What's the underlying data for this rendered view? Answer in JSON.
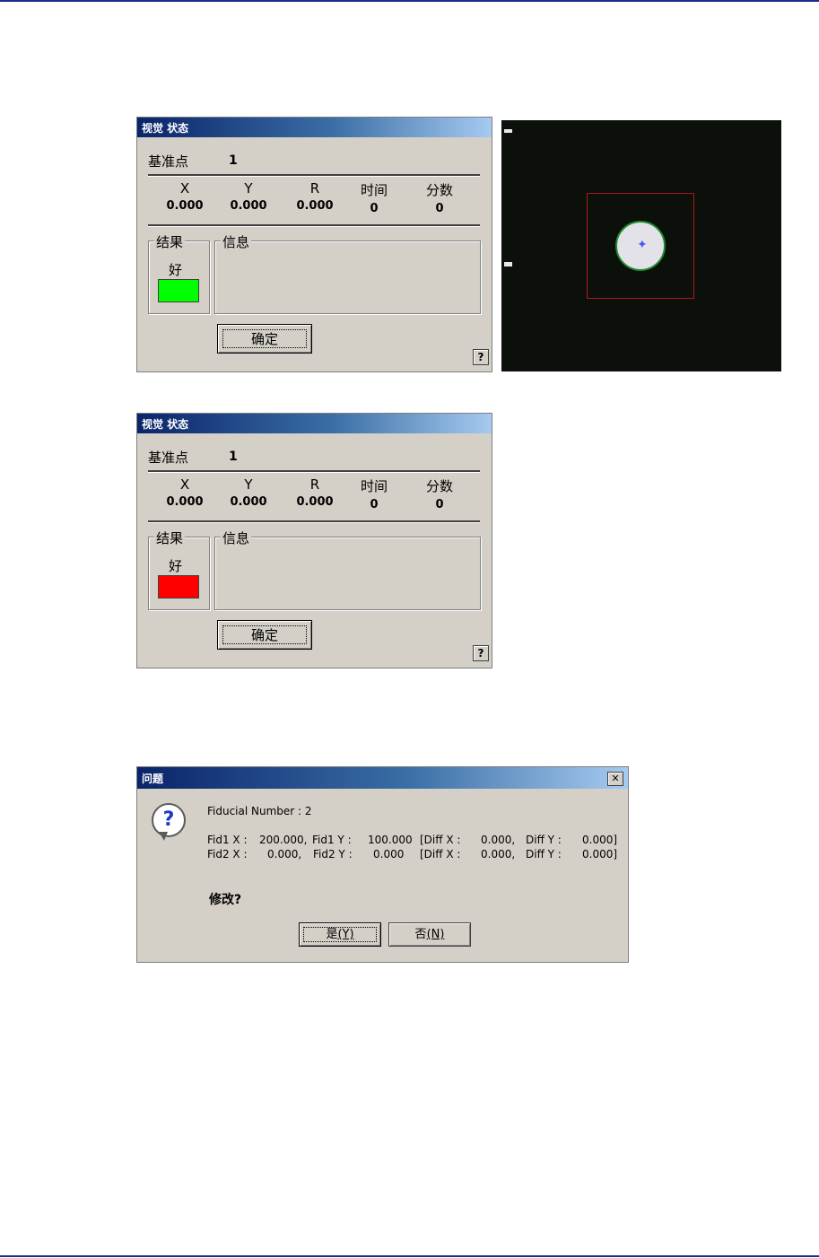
{
  "vision_dialogs": [
    {
      "title": "视觉 状态",
      "fiducial_label": "基准点",
      "fiducial_value": "1",
      "columns": [
        {
          "header": "X",
          "value": "0.000"
        },
        {
          "header": "Y",
          "value": "0.000"
        },
        {
          "header": "R",
          "value": "0.000"
        },
        {
          "header": "时间",
          "value": "0"
        },
        {
          "header": "分数",
          "value": "0"
        }
      ],
      "result_label": "结果",
      "result_value": "好",
      "result_color": "#00ff00",
      "info_label": "信息",
      "ok_label": "确定",
      "help_label": "?"
    },
    {
      "title": "视觉 状态",
      "fiducial_label": "基准点",
      "fiducial_value": "1",
      "columns": [
        {
          "header": "X",
          "value": "0.000"
        },
        {
          "header": "Y",
          "value": "0.000"
        },
        {
          "header": "R",
          "value": "0.000"
        },
        {
          "header": "时间",
          "value": "0"
        },
        {
          "header": "分数",
          "value": "0"
        }
      ],
      "result_label": "结果",
      "result_value": "好",
      "result_color": "#ff0000",
      "info_label": "信息",
      "ok_label": "确定",
      "help_label": "?"
    }
  ],
  "camera_view": {
    "background_color": "#0b100b",
    "roi_color": "#b01818",
    "fiducial_outline_color": "#1e8a2a",
    "crosshair_icon": "crosshair-icon"
  },
  "question_dialog": {
    "title": "问题",
    "close_icon": "close-icon",
    "icon": "question-icon",
    "line_fiducial_number": "Fiducial Number : 2",
    "fid1": {
      "x_label": "Fid1 X :",
      "x_value": "200.000,",
      "y_label": "Fid1 Y :",
      "y_value": "100.000",
      "diffx_label": "[Diff X :",
      "diffx_value": "0.000,",
      "diffy_label": "Diff Y :",
      "diffy_value": "0.000]"
    },
    "fid2": {
      "x_label": "Fid2 X :",
      "x_value": "0.000,",
      "y_label": "Fid2 Y :",
      "y_value": "0.000",
      "diffx_label": "[Diff X :",
      "diffx_value": "0.000,",
      "diffy_label": "Diff Y :",
      "diffy_value": "0.000]"
    },
    "prompt": "修改?",
    "yes_text": "是",
    "yes_key": "(Y)",
    "no_text": "否",
    "no_key": "(N)"
  }
}
